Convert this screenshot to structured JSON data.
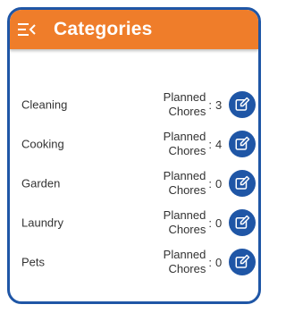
{
  "header": {
    "title": "Categories",
    "menu_icon": "menu-collapse-icon",
    "color": "#ef7d2a"
  },
  "stat_label_line1": "Planned",
  "stat_label_line2": "Chores",
  "colon": ":",
  "categories": [
    {
      "name": "Cleaning",
      "count": "3"
    },
    {
      "name": "Cooking",
      "count": "4"
    },
    {
      "name": "Garden",
      "count": "0"
    },
    {
      "name": "Laundry",
      "count": "0"
    },
    {
      "name": "Pets",
      "count": "0"
    }
  ],
  "edit_icon": "edit-icon",
  "accent": "#1f56a6"
}
